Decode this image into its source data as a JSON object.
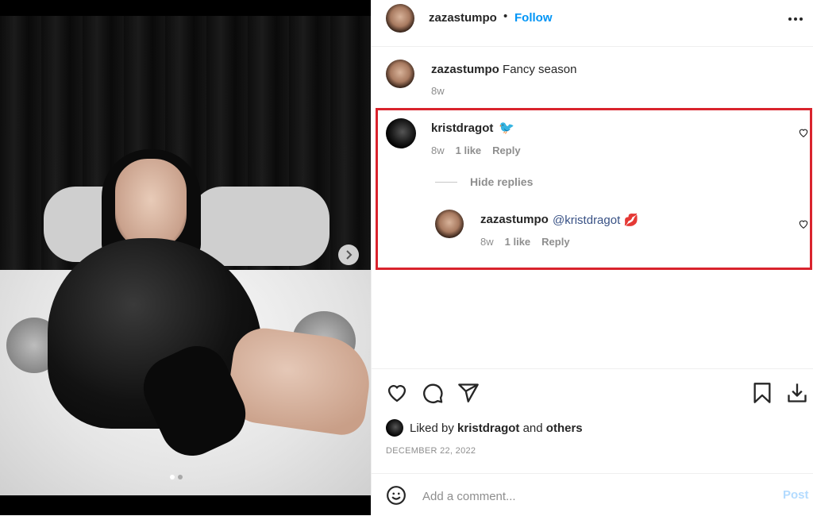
{
  "post": {
    "author": "zazastumpo",
    "separator": "•",
    "follow_label": "Follow",
    "more_icon": "more-horizontal-icon"
  },
  "caption": {
    "username": "zazastumpo",
    "text": "Fancy season",
    "time": "8w"
  },
  "comments": [
    {
      "username": "kristdragot",
      "text": "🐦",
      "time": "8w",
      "likes": "1 like",
      "reply_label": "Reply"
    }
  ],
  "hide_replies_label": "Hide replies",
  "replies": [
    {
      "username": "zazastumpo",
      "mention": "@kristdragot",
      "emoji": "💋",
      "time": "8w",
      "likes": "1 like",
      "reply_label": "Reply"
    }
  ],
  "actions": {
    "like_icon": "heart-icon",
    "comment_icon": "comment-icon",
    "share_icon": "share-icon",
    "save_icon": "bookmark-icon",
    "download_icon": "download-icon"
  },
  "likes": {
    "prefix": "Liked by",
    "user": "kristdragot",
    "middle": "and",
    "others": "others"
  },
  "date": "DECEMBER 22, 2022",
  "comment_box": {
    "placeholder": "Add a comment...",
    "post_label": "Post"
  },
  "colors": {
    "link_blue": "#0095f6",
    "highlight_red": "#d9232d",
    "muted_grey": "#8e8e8e"
  }
}
